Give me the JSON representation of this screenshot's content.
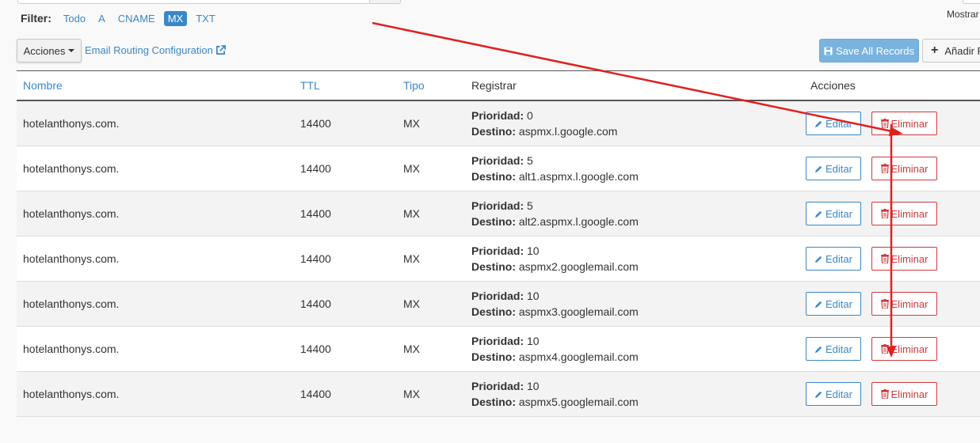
{
  "filter": {
    "label": "Filter:",
    "options": [
      "Todo",
      "A",
      "CNAME",
      "MX",
      "TXT"
    ],
    "active": "MX"
  },
  "mostrar_label": "Mostrar",
  "toolbar": {
    "acciones_label": "Acciones",
    "email_routing_label": "Email Routing Configuration",
    "save_all_label": "Save All Records",
    "add_label": "Añadir R"
  },
  "table": {
    "headers": {
      "nombre": "Nombre",
      "ttl": "TTL",
      "tipo": "Tipo",
      "registrar": "Registrar",
      "acciones": "Acciones"
    },
    "prioridad_key": "Prioridad:",
    "destino_key": "Destino:",
    "edit_label": "Editar",
    "delete_label": "Eliminar",
    "rows": [
      {
        "nombre": "hotelanthonys.com.",
        "ttl": "14400",
        "tipo": "MX",
        "prioridad": "0",
        "destino": "aspmx.l.google.com"
      },
      {
        "nombre": "hotelanthonys.com.",
        "ttl": "14400",
        "tipo": "MX",
        "prioridad": "5",
        "destino": "alt1.aspmx.l.google.com"
      },
      {
        "nombre": "hotelanthonys.com.",
        "ttl": "14400",
        "tipo": "MX",
        "prioridad": "5",
        "destino": "alt2.aspmx.l.google.com"
      },
      {
        "nombre": "hotelanthonys.com.",
        "ttl": "14400",
        "tipo": "MX",
        "prioridad": "10",
        "destino": "aspmx2.googlemail.com"
      },
      {
        "nombre": "hotelanthonys.com.",
        "ttl": "14400",
        "tipo": "MX",
        "prioridad": "10",
        "destino": "aspmx3.googlemail.com"
      },
      {
        "nombre": "hotelanthonys.com.",
        "ttl": "14400",
        "tipo": "MX",
        "prioridad": "10",
        "destino": "aspmx4.googlemail.com"
      },
      {
        "nombre": "hotelanthonys.com.",
        "ttl": "14400",
        "tipo": "MX",
        "prioridad": "10",
        "destino": "aspmx5.googlemail.com"
      }
    ]
  },
  "colors": {
    "link": "#3a87c8",
    "danger": "#d0393a",
    "annotation": "#e02020"
  }
}
